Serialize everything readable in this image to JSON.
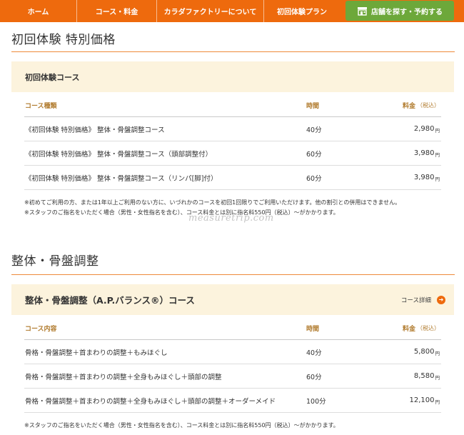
{
  "nav": {
    "items": [
      "ホーム",
      "コース・料金",
      "カラダファクトリーについて",
      "初回体験プラン"
    ],
    "cta_label": "店舗を探す・予約する",
    "cta_icon": "store-icon"
  },
  "section1": {
    "title": "初回体験 特別価格",
    "course_title": "初回体験コース",
    "headers": {
      "name": "コース種類",
      "time": "時間",
      "price": "料金",
      "price_note": "（税込）"
    },
    "rows": [
      {
        "name": "《初回体験 特別価格》 整体・骨盤調整コース",
        "time": "40分",
        "price": "2,980",
        "yen": "円"
      },
      {
        "name": "《初回体験 特別価格》 整体・骨盤調整コース（頭部調整付）",
        "time": "60分",
        "price": "3,980",
        "yen": "円"
      },
      {
        "name": "《初回体験 特別価格》 整体・骨盤調整コース（リンパ[脚]付）",
        "time": "60分",
        "price": "3,980",
        "yen": "円"
      }
    ],
    "notes": [
      "※初めてご利用の方、または1年以上ご利用のない方に、いづれかのコースを初回1回限りでご利用いただけます。他の割引との併用はできません。",
      "※スタッフのご指名をいただく場合（男性・女性指名を含む）、コース料金とは別に指名料550円（税込）〜がかかります。"
    ]
  },
  "watermark": "measuretrip.com",
  "section2": {
    "title": "整体・骨盤調整",
    "course_title": "整体・骨盤調整（A.P.バランス®）コース",
    "detail_label": "コース詳細",
    "headers": {
      "name": "コース内容",
      "time": "時間",
      "price": "料金",
      "price_note": "（税込）"
    },
    "rows": [
      {
        "name": "骨格・骨盤調整＋首まわりの調整＋もみほぐし",
        "time": "40分",
        "price": "5,800",
        "yen": "円"
      },
      {
        "name": "骨格・骨盤調整＋首まわりの調整＋全身もみほぐし＋頭部の調整",
        "time": "60分",
        "price": "8,580",
        "yen": "円"
      },
      {
        "name": "骨格・骨盤調整＋首まわりの調整＋全身もみほぐし＋頭部の調整＋オーダーメイド",
        "time": "100分",
        "price": "12,100",
        "yen": "円"
      }
    ],
    "notes": [
      "※スタッフのご指名をいただく場合（男性・女性指名を含む）、コース料金とは別に指名料550円（税込）〜がかかります。"
    ]
  },
  "colors": {
    "nav": "#ee6a0d",
    "cta": "#6da83a",
    "band": "#fcf3dd",
    "header_text": "#b07a2c"
  }
}
